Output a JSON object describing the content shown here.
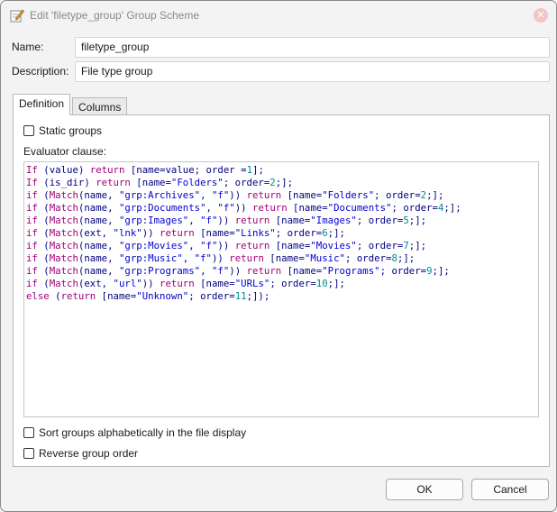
{
  "window": {
    "title": "Edit 'filetype_group' Group Scheme",
    "close_label": "✕"
  },
  "form": {
    "name_label": "Name:",
    "name_value": "filetype_group",
    "description_label": "Description:",
    "description_value": "File type group"
  },
  "tabs": [
    {
      "label": "Definition",
      "active": true
    },
    {
      "label": "Columns",
      "active": false
    }
  ],
  "definition": {
    "static_groups_label": "Static groups",
    "static_groups_checked": false,
    "evaluator_label": "Evaluator clause:",
    "code_lines": [
      [
        [
          "kw",
          "If"
        ],
        [
          "id",
          " ("
        ],
        [
          "id",
          "value"
        ],
        [
          "id",
          ") "
        ],
        [
          "kw",
          "return"
        ],
        [
          "id",
          " [name="
        ],
        [
          "id",
          "value"
        ],
        [
          "id",
          "; order ="
        ],
        [
          "num",
          "1"
        ],
        [
          "id",
          "];"
        ]
      ],
      [
        [
          "kw",
          "If"
        ],
        [
          "id",
          " ("
        ],
        [
          "id",
          "is_dir"
        ],
        [
          "id",
          ") "
        ],
        [
          "kw",
          "return"
        ],
        [
          "id",
          " [name="
        ],
        [
          "str",
          "\"Folders\""
        ],
        [
          "id",
          "; order="
        ],
        [
          "num",
          "2"
        ],
        [
          "id",
          ";];"
        ]
      ],
      [
        [
          "kw",
          "if"
        ],
        [
          "id",
          " ("
        ],
        [
          "kw",
          "Match"
        ],
        [
          "id",
          "(name, "
        ],
        [
          "str",
          "\"grp:Archives\""
        ],
        [
          "id",
          ", "
        ],
        [
          "str",
          "\"f\""
        ],
        [
          "id",
          ")) "
        ],
        [
          "kw",
          "return"
        ],
        [
          "id",
          " [name="
        ],
        [
          "str",
          "\"Folders\""
        ],
        [
          "id",
          "; order="
        ],
        [
          "num",
          "2"
        ],
        [
          "id",
          ";];"
        ]
      ],
      [
        [
          "kw",
          "if"
        ],
        [
          "id",
          " ("
        ],
        [
          "kw",
          "Match"
        ],
        [
          "id",
          "(name, "
        ],
        [
          "str",
          "\"grp:Documents\""
        ],
        [
          "id",
          ", "
        ],
        [
          "str",
          "\"f\""
        ],
        [
          "id",
          ")) "
        ],
        [
          "kw",
          "return"
        ],
        [
          "id",
          " [name="
        ],
        [
          "str",
          "\"Documents\""
        ],
        [
          "id",
          "; order="
        ],
        [
          "num",
          "4"
        ],
        [
          "id",
          ";];"
        ]
      ],
      [
        [
          "kw",
          "if"
        ],
        [
          "id",
          " ("
        ],
        [
          "kw",
          "Match"
        ],
        [
          "id",
          "(name, "
        ],
        [
          "str",
          "\"grp:Images\""
        ],
        [
          "id",
          ", "
        ],
        [
          "str",
          "\"f\""
        ],
        [
          "id",
          ")) "
        ],
        [
          "kw",
          "return"
        ],
        [
          "id",
          " [name="
        ],
        [
          "str",
          "\"Images\""
        ],
        [
          "id",
          "; order="
        ],
        [
          "num",
          "5"
        ],
        [
          "id",
          ";];"
        ]
      ],
      [
        [
          "kw",
          "if"
        ],
        [
          "id",
          " ("
        ],
        [
          "kw",
          "Match"
        ],
        [
          "id",
          "(ext, "
        ],
        [
          "str",
          "\"lnk\""
        ],
        [
          "id",
          ")) "
        ],
        [
          "kw",
          "return"
        ],
        [
          "id",
          " [name="
        ],
        [
          "str",
          "\"Links\""
        ],
        [
          "id",
          "; order="
        ],
        [
          "num",
          "6"
        ],
        [
          "id",
          ";];"
        ]
      ],
      [
        [
          "kw",
          "if"
        ],
        [
          "id",
          " ("
        ],
        [
          "kw",
          "Match"
        ],
        [
          "id",
          "(name, "
        ],
        [
          "str",
          "\"grp:Movies\""
        ],
        [
          "id",
          ", "
        ],
        [
          "str",
          "\"f\""
        ],
        [
          "id",
          ")) "
        ],
        [
          "kw",
          "return"
        ],
        [
          "id",
          " [name="
        ],
        [
          "str",
          "\"Movies\""
        ],
        [
          "id",
          "; order="
        ],
        [
          "num",
          "7"
        ],
        [
          "id",
          ";];"
        ]
      ],
      [
        [
          "kw",
          "if"
        ],
        [
          "id",
          " ("
        ],
        [
          "kw",
          "Match"
        ],
        [
          "id",
          "(name, "
        ],
        [
          "str",
          "\"grp:Music\""
        ],
        [
          "id",
          ", "
        ],
        [
          "str",
          "\"f\""
        ],
        [
          "id",
          ")) "
        ],
        [
          "kw",
          "return"
        ],
        [
          "id",
          " [name="
        ],
        [
          "str",
          "\"Music\""
        ],
        [
          "id",
          "; order="
        ],
        [
          "num",
          "8"
        ],
        [
          "id",
          ";];"
        ]
      ],
      [
        [
          "kw",
          "if"
        ],
        [
          "id",
          " ("
        ],
        [
          "kw",
          "Match"
        ],
        [
          "id",
          "(name, "
        ],
        [
          "str",
          "\"grp:Programs\""
        ],
        [
          "id",
          ", "
        ],
        [
          "str",
          "\"f\""
        ],
        [
          "id",
          ")) "
        ],
        [
          "kw",
          "return"
        ],
        [
          "id",
          " [name="
        ],
        [
          "str",
          "\"Programs\""
        ],
        [
          "id",
          "; order="
        ],
        [
          "num",
          "9"
        ],
        [
          "id",
          ";];"
        ]
      ],
      [
        [
          "kw",
          "if"
        ],
        [
          "id",
          " ("
        ],
        [
          "kw",
          "Match"
        ],
        [
          "id",
          "(ext, "
        ],
        [
          "str",
          "\"url\""
        ],
        [
          "id",
          ")) "
        ],
        [
          "kw",
          "return"
        ],
        [
          "id",
          " [name="
        ],
        [
          "str",
          "\"URLs\""
        ],
        [
          "id",
          "; order="
        ],
        [
          "num",
          "10"
        ],
        [
          "id",
          ";];"
        ]
      ],
      [
        [
          "kw",
          "else"
        ],
        [
          "id",
          " ("
        ],
        [
          "kw",
          "return"
        ],
        [
          "id",
          " [name="
        ],
        [
          "str",
          "\"Unknown\""
        ],
        [
          "id",
          "; order="
        ],
        [
          "num",
          "11"
        ],
        [
          "id",
          ";]);"
        ]
      ]
    ],
    "sort_label": "Sort groups alphabetically in the file display",
    "sort_checked": false,
    "reverse_label": "Reverse group order",
    "reverse_checked": false
  },
  "buttons": {
    "ok": "OK",
    "cancel": "Cancel"
  }
}
